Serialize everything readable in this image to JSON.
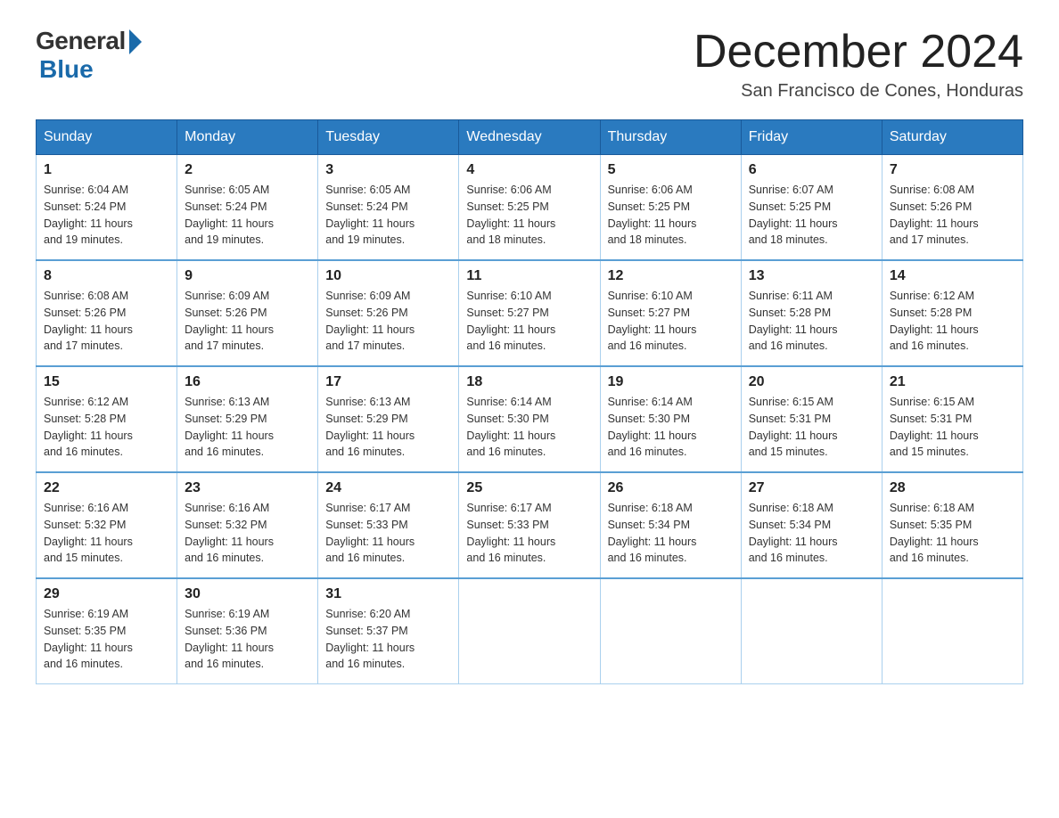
{
  "logo": {
    "general": "General",
    "blue": "Blue"
  },
  "title": "December 2024",
  "subtitle": "San Francisco de Cones, Honduras",
  "days_of_week": [
    "Sunday",
    "Monday",
    "Tuesday",
    "Wednesday",
    "Thursday",
    "Friday",
    "Saturday"
  ],
  "weeks": [
    [
      {
        "num": "1",
        "info": "Sunrise: 6:04 AM\nSunset: 5:24 PM\nDaylight: 11 hours\nand 19 minutes."
      },
      {
        "num": "2",
        "info": "Sunrise: 6:05 AM\nSunset: 5:24 PM\nDaylight: 11 hours\nand 19 minutes."
      },
      {
        "num": "3",
        "info": "Sunrise: 6:05 AM\nSunset: 5:24 PM\nDaylight: 11 hours\nand 19 minutes."
      },
      {
        "num": "4",
        "info": "Sunrise: 6:06 AM\nSunset: 5:25 PM\nDaylight: 11 hours\nand 18 minutes."
      },
      {
        "num": "5",
        "info": "Sunrise: 6:06 AM\nSunset: 5:25 PM\nDaylight: 11 hours\nand 18 minutes."
      },
      {
        "num": "6",
        "info": "Sunrise: 6:07 AM\nSunset: 5:25 PM\nDaylight: 11 hours\nand 18 minutes."
      },
      {
        "num": "7",
        "info": "Sunrise: 6:08 AM\nSunset: 5:26 PM\nDaylight: 11 hours\nand 17 minutes."
      }
    ],
    [
      {
        "num": "8",
        "info": "Sunrise: 6:08 AM\nSunset: 5:26 PM\nDaylight: 11 hours\nand 17 minutes."
      },
      {
        "num": "9",
        "info": "Sunrise: 6:09 AM\nSunset: 5:26 PM\nDaylight: 11 hours\nand 17 minutes."
      },
      {
        "num": "10",
        "info": "Sunrise: 6:09 AM\nSunset: 5:26 PM\nDaylight: 11 hours\nand 17 minutes."
      },
      {
        "num": "11",
        "info": "Sunrise: 6:10 AM\nSunset: 5:27 PM\nDaylight: 11 hours\nand 16 minutes."
      },
      {
        "num": "12",
        "info": "Sunrise: 6:10 AM\nSunset: 5:27 PM\nDaylight: 11 hours\nand 16 minutes."
      },
      {
        "num": "13",
        "info": "Sunrise: 6:11 AM\nSunset: 5:28 PM\nDaylight: 11 hours\nand 16 minutes."
      },
      {
        "num": "14",
        "info": "Sunrise: 6:12 AM\nSunset: 5:28 PM\nDaylight: 11 hours\nand 16 minutes."
      }
    ],
    [
      {
        "num": "15",
        "info": "Sunrise: 6:12 AM\nSunset: 5:28 PM\nDaylight: 11 hours\nand 16 minutes."
      },
      {
        "num": "16",
        "info": "Sunrise: 6:13 AM\nSunset: 5:29 PM\nDaylight: 11 hours\nand 16 minutes."
      },
      {
        "num": "17",
        "info": "Sunrise: 6:13 AM\nSunset: 5:29 PM\nDaylight: 11 hours\nand 16 minutes."
      },
      {
        "num": "18",
        "info": "Sunrise: 6:14 AM\nSunset: 5:30 PM\nDaylight: 11 hours\nand 16 minutes."
      },
      {
        "num": "19",
        "info": "Sunrise: 6:14 AM\nSunset: 5:30 PM\nDaylight: 11 hours\nand 16 minutes."
      },
      {
        "num": "20",
        "info": "Sunrise: 6:15 AM\nSunset: 5:31 PM\nDaylight: 11 hours\nand 15 minutes."
      },
      {
        "num": "21",
        "info": "Sunrise: 6:15 AM\nSunset: 5:31 PM\nDaylight: 11 hours\nand 15 minutes."
      }
    ],
    [
      {
        "num": "22",
        "info": "Sunrise: 6:16 AM\nSunset: 5:32 PM\nDaylight: 11 hours\nand 15 minutes."
      },
      {
        "num": "23",
        "info": "Sunrise: 6:16 AM\nSunset: 5:32 PM\nDaylight: 11 hours\nand 16 minutes."
      },
      {
        "num": "24",
        "info": "Sunrise: 6:17 AM\nSunset: 5:33 PM\nDaylight: 11 hours\nand 16 minutes."
      },
      {
        "num": "25",
        "info": "Sunrise: 6:17 AM\nSunset: 5:33 PM\nDaylight: 11 hours\nand 16 minutes."
      },
      {
        "num": "26",
        "info": "Sunrise: 6:18 AM\nSunset: 5:34 PM\nDaylight: 11 hours\nand 16 minutes."
      },
      {
        "num": "27",
        "info": "Sunrise: 6:18 AM\nSunset: 5:34 PM\nDaylight: 11 hours\nand 16 minutes."
      },
      {
        "num": "28",
        "info": "Sunrise: 6:18 AM\nSunset: 5:35 PM\nDaylight: 11 hours\nand 16 minutes."
      }
    ],
    [
      {
        "num": "29",
        "info": "Sunrise: 6:19 AM\nSunset: 5:35 PM\nDaylight: 11 hours\nand 16 minutes."
      },
      {
        "num": "30",
        "info": "Sunrise: 6:19 AM\nSunset: 5:36 PM\nDaylight: 11 hours\nand 16 minutes."
      },
      {
        "num": "31",
        "info": "Sunrise: 6:20 AM\nSunset: 5:37 PM\nDaylight: 11 hours\nand 16 minutes."
      },
      null,
      null,
      null,
      null
    ]
  ]
}
